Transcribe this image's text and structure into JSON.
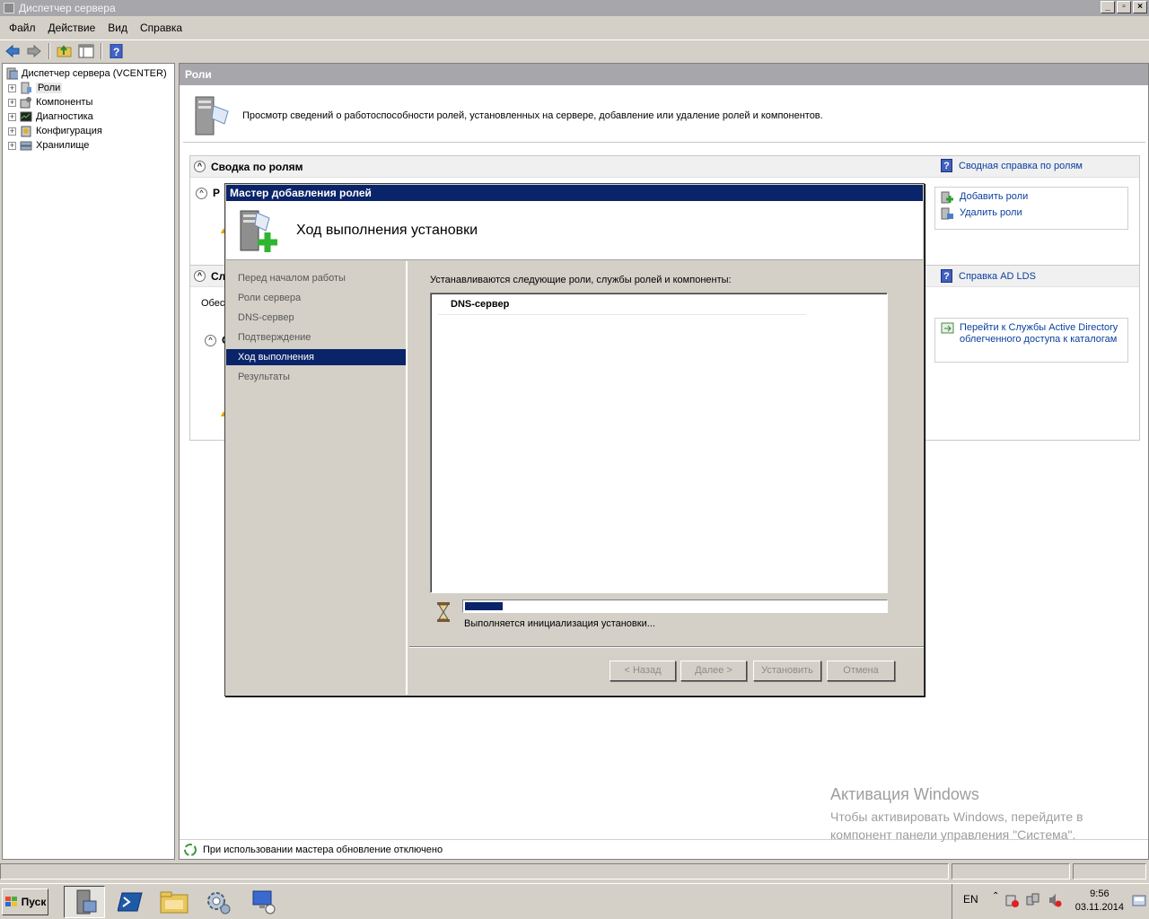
{
  "window": {
    "title": "Диспетчер сервера"
  },
  "menu": [
    "Файл",
    "Действие",
    "Вид",
    "Справка"
  ],
  "tree": {
    "root": "Диспетчер сервера (VCENTER)",
    "items": [
      "Роли",
      "Компоненты",
      "Диагностика",
      "Конфигурация",
      "Хранилище"
    ]
  },
  "main": {
    "header": "Роли",
    "intro": "Просмотр сведений о работоспособности ролей, установленных на сервере, добавление или удаление ролей и компонентов.",
    "summary_title": "Сводка по ролям",
    "summary_help": "Сводная справка по ролям",
    "add_roles": "Добавить роли",
    "remove_roles": "Удалить роли",
    "section2_title": "Сл",
    "section2_text": "Обес",
    "inner_title1": "Р",
    "inner_title2": "С",
    "ad_help": "Справка AD LDS",
    "ad_link": "Перейти к Службы Active Directory облегченного доступа к каталогам",
    "status": "При использовании мастера обновление отключено"
  },
  "activation": {
    "title": "Активация Windows",
    "text": "Чтобы активировать Windows, перейдите в компонент панели управления \"Система\"."
  },
  "wizard": {
    "title": "Мастер добавления ролей",
    "header": "Ход выполнения установки",
    "nav": [
      "Перед началом работы",
      "Роли сервера",
      "DNS-сервер",
      "Подтверждение",
      "Ход выполнения",
      "Результаты"
    ],
    "active_nav": 4,
    "caption": "Устанавливаются следующие роли, службы ролей и компоненты:",
    "items": [
      "DNS-сервер"
    ],
    "progress": 0.09,
    "progress_text": "Выполняется инициализация установки...",
    "buttons": {
      "back": "< Назад",
      "next": "Далее >",
      "install": "Установить",
      "cancel": "Отмена"
    }
  },
  "taskbar": {
    "start": "Пуск",
    "lang": "EN",
    "time": "9:56",
    "date": "03.11.2014"
  }
}
